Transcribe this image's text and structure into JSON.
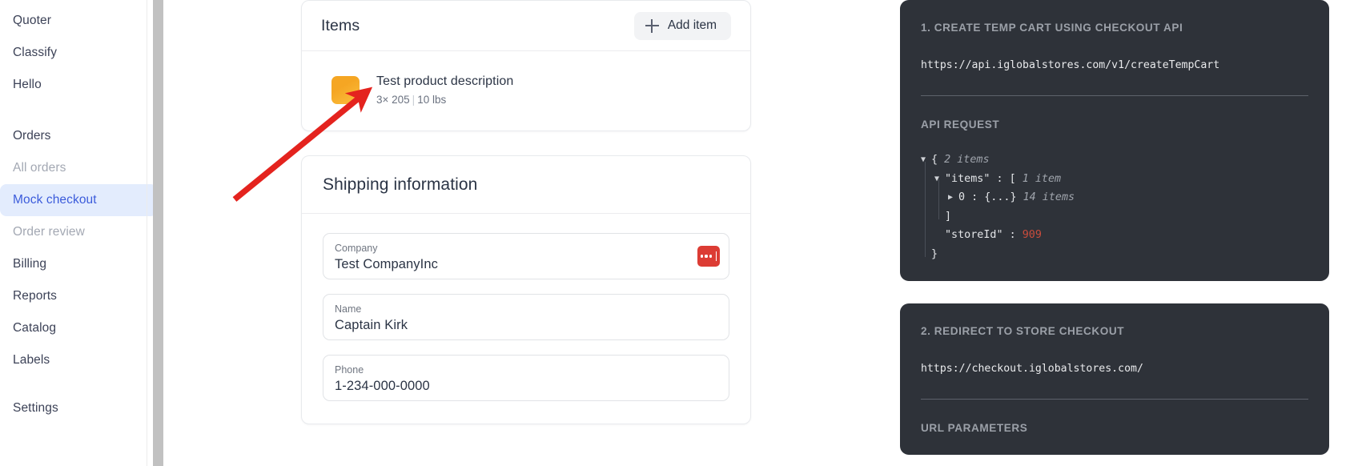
{
  "sidebar": {
    "top_items": [
      {
        "label": "Quoter",
        "state": "normal"
      },
      {
        "label": "Classify",
        "state": "normal"
      },
      {
        "label": "Hello",
        "state": "normal"
      }
    ],
    "section_label": "Orders",
    "order_items": [
      {
        "label": "All orders",
        "state": "muted"
      },
      {
        "label": "Mock checkout",
        "state": "active"
      },
      {
        "label": "Order review",
        "state": "muted"
      }
    ],
    "other_items": [
      {
        "label": "Billing",
        "state": "normal"
      },
      {
        "label": "Reports",
        "state": "normal"
      },
      {
        "label": "Catalog",
        "state": "normal"
      },
      {
        "label": "Labels",
        "state": "normal"
      }
    ],
    "settings_label": "Settings",
    "active_color": "#3b5bdb",
    "active_bg": "#e3ecfd"
  },
  "items_card": {
    "title": "Items",
    "add_button_label": "Add item",
    "add_button_icon": "plus-icon",
    "item": {
      "thumbnail_color": "#f5a623",
      "name": "Test product description",
      "quantity": "3× 205",
      "separator": "|",
      "weight": "10 lbs"
    }
  },
  "shipping_card": {
    "title": "Shipping information",
    "fields": [
      {
        "label": "Company",
        "value": "Test CompanyInc",
        "has_badge": true,
        "badge_icon": "ellipsis-icon",
        "badge_color": "#dc3c34"
      },
      {
        "label": "Name",
        "value": "Captain Kirk",
        "has_badge": false
      },
      {
        "label": "Phone",
        "value": "1-234-000-0000",
        "has_badge": false
      }
    ]
  },
  "right_panel": {
    "steps": [
      {
        "title": "1. CREATE TEMP CART USING CHECKOUT API",
        "url": "https://api.iglobalstores.com/v1/createTempCart",
        "section_label": "API REQUEST",
        "json_tree": [
          {
            "indent": 0,
            "twisty": "▼",
            "text": "{",
            "meta": "2 items"
          },
          {
            "indent": 1,
            "twisty": "▼",
            "text": "\"items\" : [",
            "meta": "1 item"
          },
          {
            "indent": 2,
            "twisty": "▶",
            "text": "0 : {...}",
            "meta": "14 items"
          },
          {
            "indent": 1,
            "twisty": "",
            "text": "]",
            "meta": ""
          },
          {
            "indent": 1,
            "twisty": "",
            "text": "\"storeId\" : ",
            "number": "909",
            "meta": ""
          },
          {
            "indent": 0,
            "twisty": "",
            "text": "}",
            "meta": ""
          }
        ]
      },
      {
        "title": "2. REDIRECT TO STORE CHECKOUT",
        "url": "https://checkout.iglobalstores.com/",
        "section_label": "URL PARAMETERS"
      }
    ]
  },
  "annotation": {
    "type": "arrow",
    "color": "#e4231e",
    "points_to": "product-thumbnail"
  }
}
